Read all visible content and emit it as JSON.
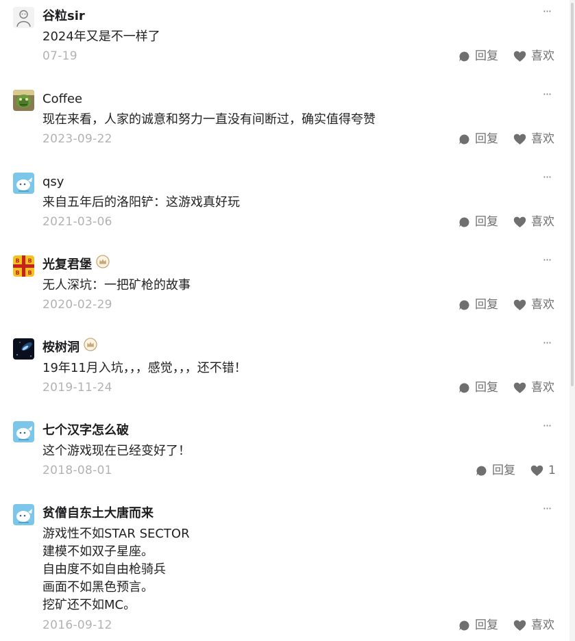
{
  "comments": [
    {
      "user": "谷粒sir",
      "lines": [
        "2024年又是不一样了"
      ],
      "date": "07-19",
      "reply_label": "回复",
      "like_label": "喜欢",
      "avatar": "line-art-figure-avatar",
      "badge": false,
      "more_icon": "ellipsis-icon"
    },
    {
      "user": "Coffee",
      "lines": [
        "现在来看，人家的诚意和努力一直没有间断过，确实值得夸赞"
      ],
      "date": "2023-09-22",
      "reply_label": "回复",
      "like_label": "喜欢",
      "avatar": "green-creature-avatar",
      "badge": false,
      "more_icon": "ellipsis-icon"
    },
    {
      "user": "qsy",
      "lines": [
        "来自五年后的洛阳铲：这游戏真好玩"
      ],
      "date": "2021-03-06",
      "reply_label": "回复",
      "like_label": "喜欢",
      "avatar": "blue-whale-avatar",
      "badge": false,
      "more_icon": "ellipsis-icon"
    },
    {
      "user": "光复君堡",
      "lines": [
        "无人深坑：一把矿枪的故事"
      ],
      "date": "2020-02-29",
      "reply_label": "回复",
      "like_label": "喜欢",
      "avatar": "red-cross-flag-avatar",
      "badge": true,
      "more_icon": "ellipsis-icon"
    },
    {
      "user": "桉树洞",
      "lines": [
        "19年11月入坑，，，感觉，，，还不错！"
      ],
      "date": "2019-11-24",
      "reply_label": "回复",
      "like_label": "喜欢",
      "avatar": "space-nebula-avatar",
      "badge": true,
      "more_icon": "ellipsis-icon"
    },
    {
      "user": "七个汉字怎么破",
      "lines": [
        "这个游戏现在已经变好了！"
      ],
      "date": "2018-08-01",
      "reply_label": "回复",
      "like_label": "1",
      "avatar": "blue-whale-avatar",
      "badge": false,
      "more_icon": "ellipsis-icon"
    },
    {
      "user": "贫僧自东土大唐而来",
      "lines": [
        "游戏性不如STAR SECTOR",
        "建模不如双子星座。",
        "自由度不如自由枪骑兵",
        "画面不如黑色预言。",
        "挖矿还不如MC。"
      ],
      "date": "2016-09-12",
      "reply_label": "回复",
      "like_label": "喜欢",
      "avatar": "blue-whale-avatar",
      "badge": false,
      "more_icon": "ellipsis-icon"
    }
  ],
  "more_glyph": "···",
  "icons": {
    "reply": "speech-bubble-icon",
    "like": "heart-icon",
    "badge": "crown-badge-icon"
  },
  "colors": {
    "action_icon": "#6f6f6f",
    "date": "#b2b2b2",
    "badge": "#c8a878"
  }
}
